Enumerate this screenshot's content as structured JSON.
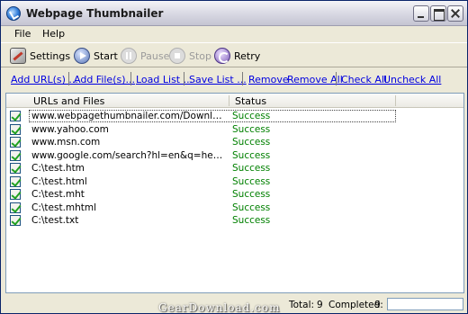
{
  "window": {
    "title": "Webpage Thumbnailer"
  },
  "menu": {
    "file": "File",
    "help": "Help"
  },
  "toolbar": {
    "settings": "Settings",
    "start": "Start",
    "pause": "Pause",
    "stop": "Stop",
    "retry": "Retry"
  },
  "links": {
    "add_urls": "Add URL(s) ...",
    "add_files": "Add File(s)...",
    "load_list": "Load List ...",
    "save_list": "Save List ...",
    "remove": "Remove",
    "remove_all": "Remove All",
    "check_all": "Check All",
    "uncheck_all": "Uncheck All"
  },
  "list": {
    "headers": {
      "url": "URLs and Files",
      "status": "Status"
    },
    "rows": [
      {
        "url": "www.webpagethumbnailer.com/Download.html",
        "status": "Success",
        "checked": true
      },
      {
        "url": "www.yahoo.com",
        "status": "Success",
        "checked": true
      },
      {
        "url": "www.msn.com",
        "status": "Success",
        "checked": true
      },
      {
        "url": "www.google.com/search?hl=en&q=hello+world&b...",
        "status": "Success",
        "checked": true
      },
      {
        "url": "C:\\test.htm",
        "status": "Success",
        "checked": true
      },
      {
        "url": "C:\\test.html",
        "status": "Success",
        "checked": true
      },
      {
        "url": "C:\\test.mht",
        "status": "Success",
        "checked": true
      },
      {
        "url": "C:\\test.mhtml",
        "status": "Success",
        "checked": true
      },
      {
        "url": "C:\\test.txt",
        "status": "Success",
        "checked": true
      }
    ]
  },
  "status": {
    "total_label": "Total:",
    "total": "9",
    "completed_label": "Completed:",
    "completed": "9",
    "progress_fraction": 0
  },
  "watermark": "GearDownload.com",
  "colors": {
    "success": "#008000",
    "link": "#0000e0",
    "frame": "#ece9d8"
  }
}
